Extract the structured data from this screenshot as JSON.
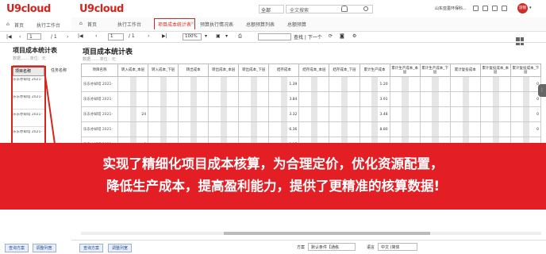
{
  "back": {
    "logo": "U9cloud",
    "tabs": [
      "首页",
      "执行工作台"
    ],
    "page_of": "/ 1",
    "page_value": "1",
    "title": "项目成本统计表",
    "subtitle": "数据……  单位：元",
    "col_headers": [
      "项目名称",
      "任务名称"
    ],
    "rows": [
      "乐东亦却塔 2021-",
      "乐东亦却塔 2021-",
      "乐东亦却塔 2021-",
      "乐东亦却塔 2021-"
    ],
    "buttons": [
      "查询方案",
      "调整列宽"
    ]
  },
  "top": {
    "logo": "U9cloud",
    "scope": "全部",
    "search_placeholder": "全文搜索",
    "org": "山东亚墨环保科...",
    "user": "游锦"
  },
  "tabs": [
    "首页",
    "执行工作台",
    "项目成本统计表",
    "预算执行情况表",
    "总额预算列表",
    "总额预算"
  ],
  "active_tab": "项目成本统计表",
  "toolbar": {
    "page_value": "1",
    "page_of": "/ 1",
    "zoom": "100%",
    "find_next": "查找 | 下一个"
  },
  "report": {
    "title": "项目成本统计表",
    "subtitle": "数据……  单位：元",
    "headers": [
      "项目名称",
      "转入成本_本层",
      "转入成本_下层",
      "转出成本",
      "转出成本_本层",
      "转出成本_下层",
      "结存成本",
      "结存成本_本层",
      "结存成本_下层",
      "累计生产成本",
      "累计生产成本_本层",
      "累计生产成本_下层",
      "累计复投成本",
      "累计复投成本_本层",
      "累计复投成本_下层"
    ],
    "rows": [
      {
        "name": "乐东亦却塔 2021-",
        "v": [
          "",
          "",
          "",
          "",
          "",
          "1.39",
          "",
          "",
          "1.20",
          "",
          "",
          "",
          "",
          "0"
        ]
      },
      {
        "name": "乐东亦却塔 2021-",
        "v": [
          "",
          "",
          "",
          "",
          "",
          "3.84",
          "",
          "",
          "3.91",
          "",
          "",
          "",
          "",
          "0"
        ]
      },
      {
        "name": "乐东亦却塔 2021-",
        "v": [
          "24",
          "",
          "",
          "",
          "",
          "3.32",
          "",
          "",
          "3.48",
          "",
          "",
          "",
          "",
          "0"
        ]
      },
      {
        "name": "乐东亦却塔 2021-",
        "v": [
          "",
          "",
          "",
          "",
          "",
          "6.36",
          "",
          "",
          "8.80",
          "",
          "",
          "",
          "",
          "0"
        ]
      },
      {
        "name": "乐东亦却塔 2021-",
        "v": [
          "0",
          "",
          "",
          "",
          "",
          "3.17",
          "",
          "",
          "",
          "",
          "",
          "",
          "",
          ""
        ]
      },
      {
        "name": "",
        "v": [
          "",
          "",
          "",
          "",
          "",
          "",
          "",
          "",
          "",
          "",
          "",
          "",
          "",
          ""
        ]
      }
    ]
  },
  "bottom": {
    "buttons": [
      "查询方案",
      "调整列宽"
    ],
    "scheme_label": "方案",
    "scheme_value": "默认条件【通栋",
    "lang_label": "语言",
    "lang_value": "中文 (简体"
  },
  "banner": {
    "line1": "实现了精细化项目成本核算，为合理定价，优化资源配置，",
    "line2": "降低生产成本，提高盈利能力，提供了更精准的核算数据!"
  },
  "colors": {
    "brand": "#d9241c",
    "banner": "#e31e24"
  }
}
